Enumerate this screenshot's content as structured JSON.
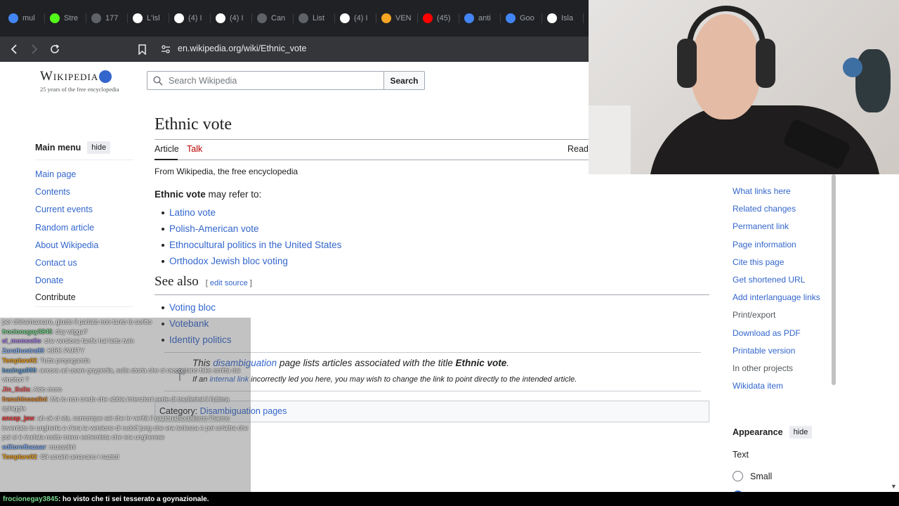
{
  "browser": {
    "tabs": [
      {
        "label": "mul",
        "icon": "google-icon",
        "color": "#4285f4"
      },
      {
        "label": "Stre",
        "icon": "kick-icon",
        "color": "#53fc18"
      },
      {
        "label": "177",
        "icon": "page-icon",
        "color": "#5f6368"
      },
      {
        "label": "L'isl",
        "icon": "google-g-icon",
        "color": "#ffffff"
      },
      {
        "label": "(4) I",
        "icon": "x-icon",
        "color": "#ffffff"
      },
      {
        "label": "(4) I",
        "icon": "x-icon",
        "color": "#ffffff"
      },
      {
        "label": "Can",
        "icon": "globe-icon",
        "color": "#5f6368"
      },
      {
        "label": "List",
        "icon": "globe-icon",
        "color": "#5f6368"
      },
      {
        "label": "(4) I",
        "icon": "x-icon",
        "color": "#ffffff"
      },
      {
        "label": "VEN",
        "icon": "sun-icon",
        "color": "#f5a623"
      },
      {
        "label": "(45)",
        "icon": "youtube-icon",
        "color": "#ff0000"
      },
      {
        "label": "anti",
        "icon": "google-icon",
        "color": "#4285f4"
      },
      {
        "label": "Goo",
        "icon": "translate-icon",
        "color": "#4285f4"
      },
      {
        "label": "Isla",
        "icon": "wikipedia-icon",
        "color": "#ffffff"
      }
    ],
    "url": "en.wikipedia.org/wiki/Ethnic_vote"
  },
  "wiki": {
    "logo_word": "Wikipedia",
    "logo_tagline": "25 years of the free encyclopedia",
    "search_placeholder": "Search Wikipedia",
    "search_button": "Search",
    "main_menu": {
      "title": "Main menu",
      "hide": "hide",
      "items": [
        "Main page",
        "Contents",
        "Current events",
        "Random article",
        "About Wikipedia",
        "Contact us",
        "Donate"
      ],
      "contribute": "Contribute"
    },
    "title": "Ethnic vote",
    "tabs": {
      "article": "Article",
      "talk": "Talk",
      "read": "Read"
    },
    "from": "From Wikipedia, the free encyclopedia",
    "intro_bold": "Ethnic vote",
    "intro_rest": " may refer to:",
    "links": [
      "Latino vote",
      "Polish-American vote",
      "Ethnocultural politics in the United States",
      "Orthodox Jewish bloc voting"
    ],
    "see_also": {
      "heading": "See also",
      "edit_open": "[ ",
      "edit_label": "edit source",
      "edit_close": " ]",
      "items": [
        "Voting bloc",
        "Votebank",
        "Identity politics"
      ]
    },
    "disambig": {
      "line1_a": "This ",
      "line1_link": "disambiguation",
      "line1_b": " page lists articles associated with the title ",
      "line1_title": "Ethnic vote",
      "line1_end": ".",
      "line2_a": "If an ",
      "line2_link": "internal link",
      "line2_b": " incorrectly led you here, you may wish to change the link to point directly to the intended article."
    },
    "category": {
      "label": "Category: ",
      "link": "Disambiguation pages"
    },
    "tools": [
      "What links here",
      "Related changes",
      "Permanent link",
      "Page information",
      "Cite this page",
      "Get shortened URL",
      "Add interlanguage links"
    ],
    "print_export": "Print/export",
    "print_items": [
      "Download as PDF",
      "Printable version"
    ],
    "other_projects": "In other projects",
    "other_items": [
      "Wikidata item"
    ],
    "appearance": {
      "title": "Appearance",
      "hide": "hide",
      "text_label": "Text",
      "option_small": "Small"
    }
  },
  "chat": {
    "lines": [
      {
        "user": "",
        "user_color": "#ffffff",
        "text": "per chinamaxxare, giusto il parlato non tanto lo scritto"
      },
      {
        "user": "frocionegay3845",
        "user_color": "#7bd88f",
        "text": ": day wigga?"
      },
      {
        "user": "el_momoello",
        "user_color": "#b48cf2",
        "text": ": che versione fanfic hai letto twin"
      },
      {
        "user": "Zarathustra89",
        "user_color": "#8ab4f8",
        "text": ": KIRK PARTY"
      },
      {
        "user": "Templare02",
        "user_color": "#f5a623",
        "text": ": Tutta propaganda"
      },
      {
        "user": "bazinga999",
        "user_color": "#6fa8dc",
        "text": ": ancora ad usare goypedia, sulla storia che ci raccontano fake scritta dai vincitori ?"
      },
      {
        "user": "Jin_Sulla",
        "user_color": "#ff6b6b",
        "text": ": Aldo moro"
      },
      {
        "user": "franchinosalini",
        "user_color": "#e69138",
        "text": ": Ma io non credo che abbia intenzioni serie di trasferirsi li l'ultima spiaggia"
      },
      {
        "user": "ancap_jew",
        "user_color": "#ff4d4d",
        "text": ": ah ok ci sta. comunque sai che in verità il nazionalsocialismo l'hanno inventato in ungheria e c'era la versione di rudolf jung che era tedesca e poi un'altra che poi si è rivelata molto meno estremista che era ungherese"
      },
      {
        "user": "editorofbazaar",
        "user_color": "#8ab4f8",
        "text": ": mussolini"
      },
      {
        "user": "Templare02",
        "user_color": "#f5a623",
        "text": ": Gli ucraini amavano i nazisti"
      }
    ],
    "ticker_user": "frocionegay3845",
    "ticker_text": " : ho visto che ti sei tesserato a goynazionale."
  }
}
